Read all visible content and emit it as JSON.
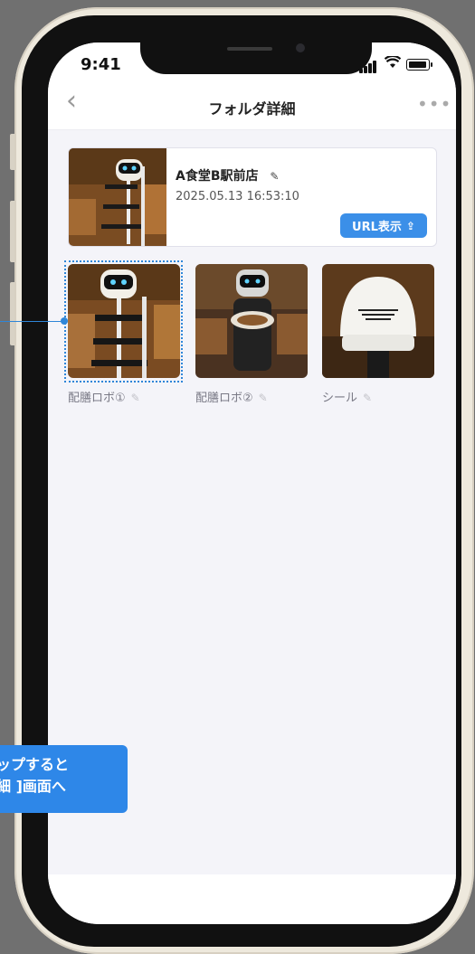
{
  "status_bar": {
    "time": "9:41"
  },
  "nav": {
    "back_icon": "‹",
    "title": "フォルダ詳細",
    "more_icon": "•••"
  },
  "folder": {
    "name": "A食堂B駅前店",
    "edit_icon": "✎",
    "date": "2025.05.13 16:53:10",
    "url_button_label": "URL表示",
    "share_icon": "⇪"
  },
  "items": [
    {
      "label": "配膳ロボ①",
      "edit_icon": "✎",
      "selected": true
    },
    {
      "label": "配膳ロボ②",
      "edit_icon": "✎",
      "selected": false
    },
    {
      "label": "シール",
      "edit_icon": "✎",
      "selected": false
    }
  ],
  "callout": {
    "line1": "ップすると",
    "line2": "細 ]画面へ"
  },
  "colors": {
    "accent": "#3b8fe8",
    "background": "#f4f4f9",
    "frame": "#eee9dd"
  }
}
